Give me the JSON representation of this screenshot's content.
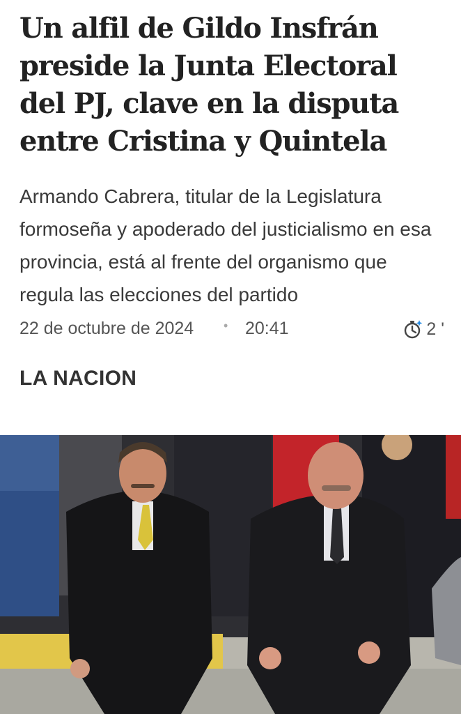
{
  "article": {
    "headline": "Un alfil de Gildo Insfrán preside la Junta Electoral del PJ, clave en la disputa entre Cristina y Quintela",
    "subtitle": "Armando Cabrera, titular de la Legislatura formoseña y apoderado del justicialismo en esa provincia, está al frente del organismo que regula las elecciones del partido",
    "date": "22 de octubre de 2024",
    "separator": "•",
    "time": "20:41",
    "reading_time": "2 '",
    "source": "LA NACION"
  },
  "icons": {
    "reading_time": "stopwatch-icon"
  },
  "colors": {
    "headline": "#222222",
    "body_text": "#3a3a3a",
    "meta_text": "#555555",
    "icon_accent": "#1e88e5"
  },
  "photo": {
    "subject": "news-photo"
  }
}
